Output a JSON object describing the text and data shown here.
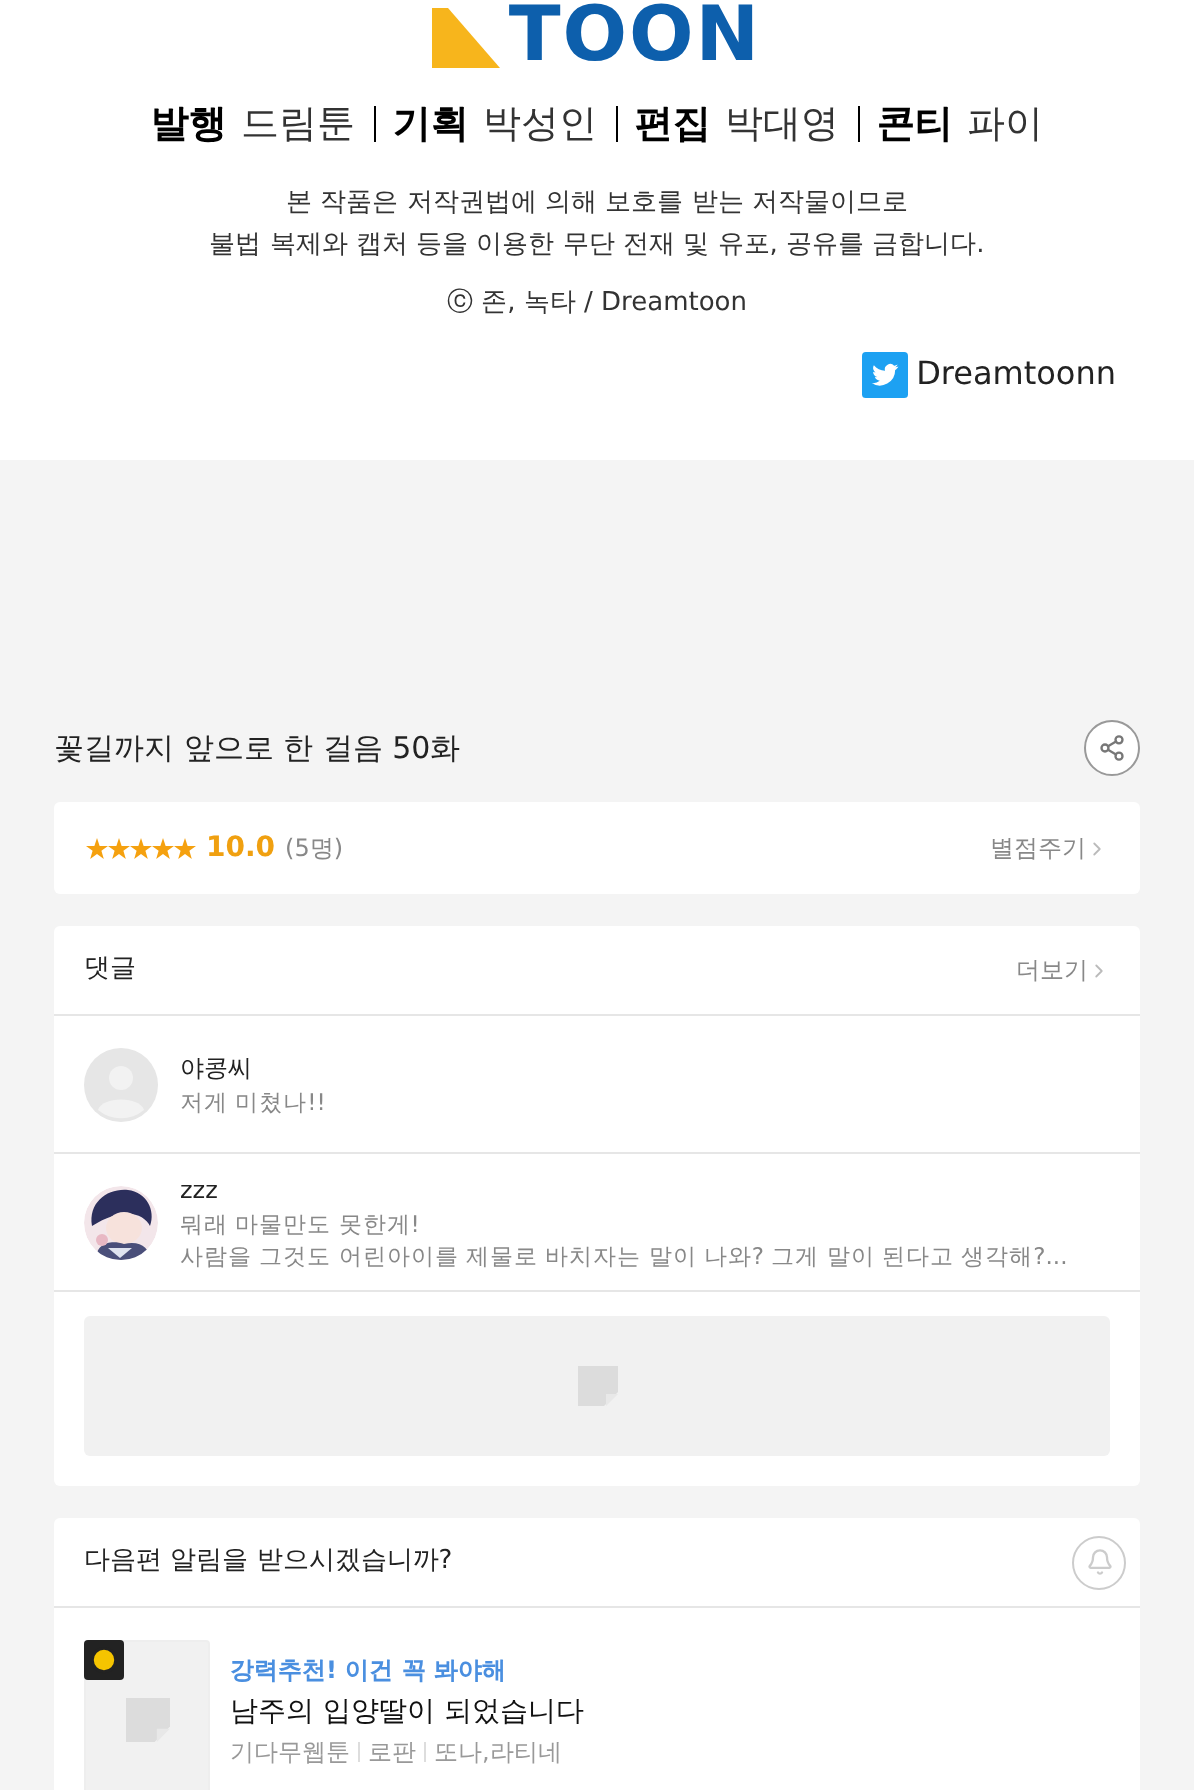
{
  "credits": {
    "logo": "TOON",
    "roles": [
      {
        "role": "발행",
        "name": "드림툰"
      },
      {
        "role": "기획",
        "name": "박성인"
      },
      {
        "role": "편집",
        "name": "박대영"
      },
      {
        "role": "콘티",
        "name": "파이"
      }
    ],
    "notice": [
      "본 작품은 저작권법에 의해 보호를 받는 저작물이므로",
      "불법 복제와 캡처 등을 이용한 무단 전재 및 유포, 공유를 금합니다."
    ],
    "copyright": "ⓒ 존, 녹타 / Dreamtoon",
    "twitter": "Dreamtoonn"
  },
  "episode": {
    "title": "꽃길까지 앞으로 한 걸음 50화"
  },
  "rating": {
    "stars": 5,
    "score": "10.0",
    "count": "(5명)",
    "action": "별점주기"
  },
  "comments": {
    "title": "댓글",
    "more": "더보기",
    "items": [
      {
        "kind": "default",
        "author": "야콩씨",
        "lines": [
          "저게 미쳤나!!"
        ]
      },
      {
        "kind": "picture",
        "author": "zzz",
        "lines": [
          "뭐래 마물만도 못한게!",
          "사람을 그것도 어린아이를 제물로 바치자는 말이 나와? 그게 말이 된다고 생각해?..."
        ]
      }
    ]
  },
  "notification": {
    "question": "다음편 알림을 받으시겠습니까?"
  },
  "recommendation": {
    "tag": "강력추천! 이건 꼭 봐야해",
    "title": "남주의 입양딸이 되었습니다",
    "meta": [
      "기다무웹툰",
      "로판",
      "또나,라티네"
    ]
  }
}
